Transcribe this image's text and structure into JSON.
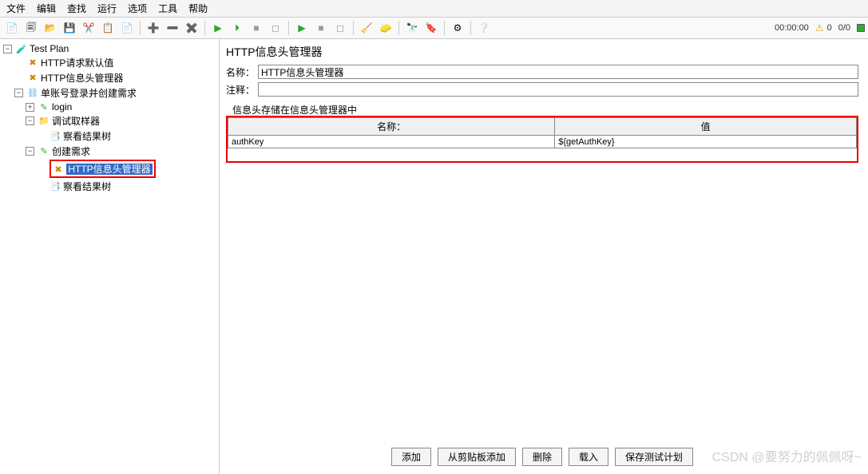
{
  "menu": {
    "file": "文件",
    "edit": "编辑",
    "search": "查找",
    "run": "运行",
    "options": "选项",
    "tools": "工具",
    "help": "帮助"
  },
  "status": {
    "timer": "00:00:00",
    "warn_count": "0",
    "progress": "0/0"
  },
  "tree": {
    "root": "Test Plan",
    "n1": "HTTP请求默认值",
    "n2": "HTTP信息头管理器",
    "n3": "单账号登录并创建需求",
    "n4": "login",
    "n5": "调试取样器",
    "n6": "察看结果树",
    "n7": "创建需求",
    "n8": "HTTP信息头管理器",
    "n9": "察看结果树"
  },
  "panel": {
    "title": "HTTP信息头管理器",
    "name_label": "名称：",
    "name_value": "HTTP信息头管理器",
    "comment_label": "注释：",
    "comment_value": "",
    "fieldset": "信息头存储在信息头管理器中",
    "col_name": "名称：",
    "col_value": "值",
    "rows": [
      {
        "name": "authKey",
        "value": "${getAuthKey}"
      }
    ]
  },
  "buttons": {
    "add": "添加",
    "clip": "从剪贴板添加",
    "del": "删除",
    "load": "载入",
    "save": "保存测试计划"
  },
  "watermark": "CSDN @要努力的佩佩呀~"
}
